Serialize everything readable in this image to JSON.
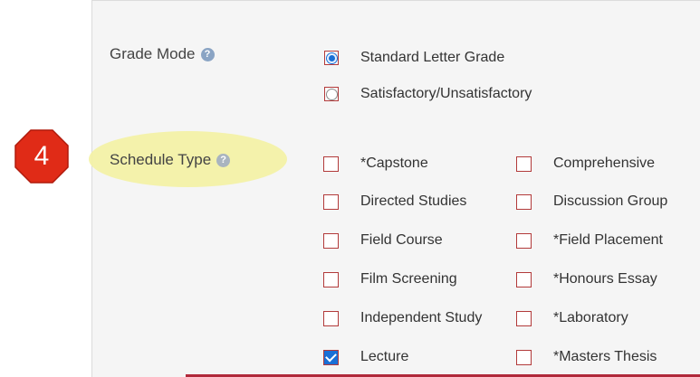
{
  "grade_mode": {
    "label": "Grade Mode",
    "help_icon": "help-icon",
    "options": [
      {
        "label": "Standard Letter Grade",
        "selected": true
      },
      {
        "label": "Satisfactory/Unsatisfactory",
        "selected": false
      }
    ]
  },
  "schedule_type": {
    "label": "Schedule Type",
    "help_icon": "help-icon",
    "step_number": "4",
    "left_options": [
      {
        "label": "*Capstone",
        "checked": false
      },
      {
        "label": "Directed Studies",
        "checked": false
      },
      {
        "label": "Field Course",
        "checked": false
      },
      {
        "label": "Film Screening",
        "checked": false
      },
      {
        "label": "Independent Study",
        "checked": false
      },
      {
        "label": "Lecture",
        "checked": true
      }
    ],
    "right_options": [
      {
        "label": "Comprehensive",
        "checked": false
      },
      {
        "label": "Discussion Group",
        "checked": false
      },
      {
        "label": "*Field Placement",
        "checked": false
      },
      {
        "label": "*Honours Essay",
        "checked": false
      },
      {
        "label": "*Laboratory",
        "checked": false
      },
      {
        "label": "*Masters Thesis",
        "checked": false
      }
    ]
  },
  "colors": {
    "step_badge": "#e02b17",
    "highlight": "#f4f2a3",
    "control_border": "#b23a3a",
    "selected_blue": "#1a6fd6"
  }
}
